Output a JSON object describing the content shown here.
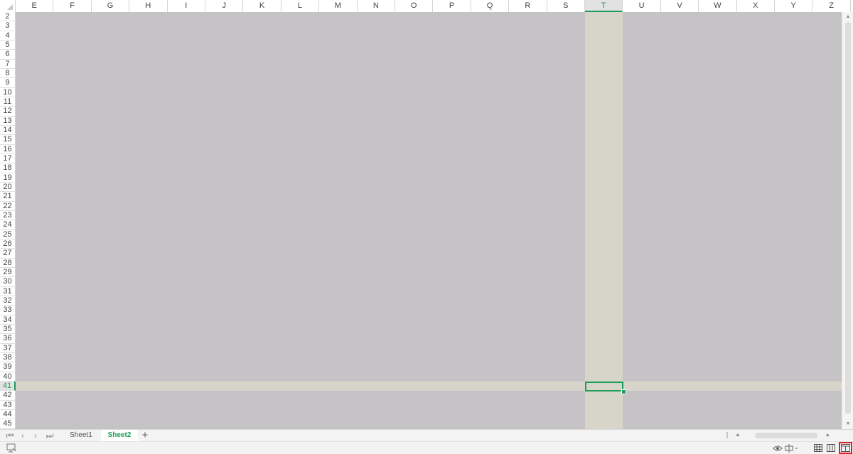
{
  "spreadsheet": {
    "columns": [
      "E",
      "F",
      "G",
      "H",
      "I",
      "J",
      "K",
      "L",
      "M",
      "N",
      "O",
      "P",
      "Q",
      "R",
      "S",
      "T",
      "U",
      "V",
      "W",
      "X",
      "Y",
      "Z"
    ],
    "rows": [
      "2",
      "3",
      "4",
      "5",
      "6",
      "7",
      "8",
      "9",
      "10",
      "11",
      "12",
      "13",
      "14",
      "15",
      "16",
      "17",
      "18",
      "19",
      "20",
      "21",
      "22",
      "23",
      "24",
      "25",
      "26",
      "27",
      "28",
      "29",
      "30",
      "31",
      "32",
      "33",
      "34",
      "35",
      "36",
      "37",
      "38",
      "39",
      "40",
      "41",
      "42",
      "43",
      "44",
      "45"
    ],
    "selected_column": "T",
    "selected_row": "41",
    "colors": {
      "grid_background": "#c6c3c6",
      "highlight": "#d7d5c9",
      "accent": "#1e9c5a"
    }
  },
  "sheet_tabs": {
    "tabs": [
      {
        "label": "Sheet1",
        "active": false
      },
      {
        "label": "Sheet2",
        "active": true
      }
    ],
    "add_label": "+"
  },
  "status_bar": {
    "icons": [
      "macro-icon",
      "eye-protection-icon",
      "input-method-icon",
      "normal-view-icon",
      "page-layout-view-icon",
      "page-break-preview-icon"
    ],
    "active_view": "page-break-preview"
  }
}
